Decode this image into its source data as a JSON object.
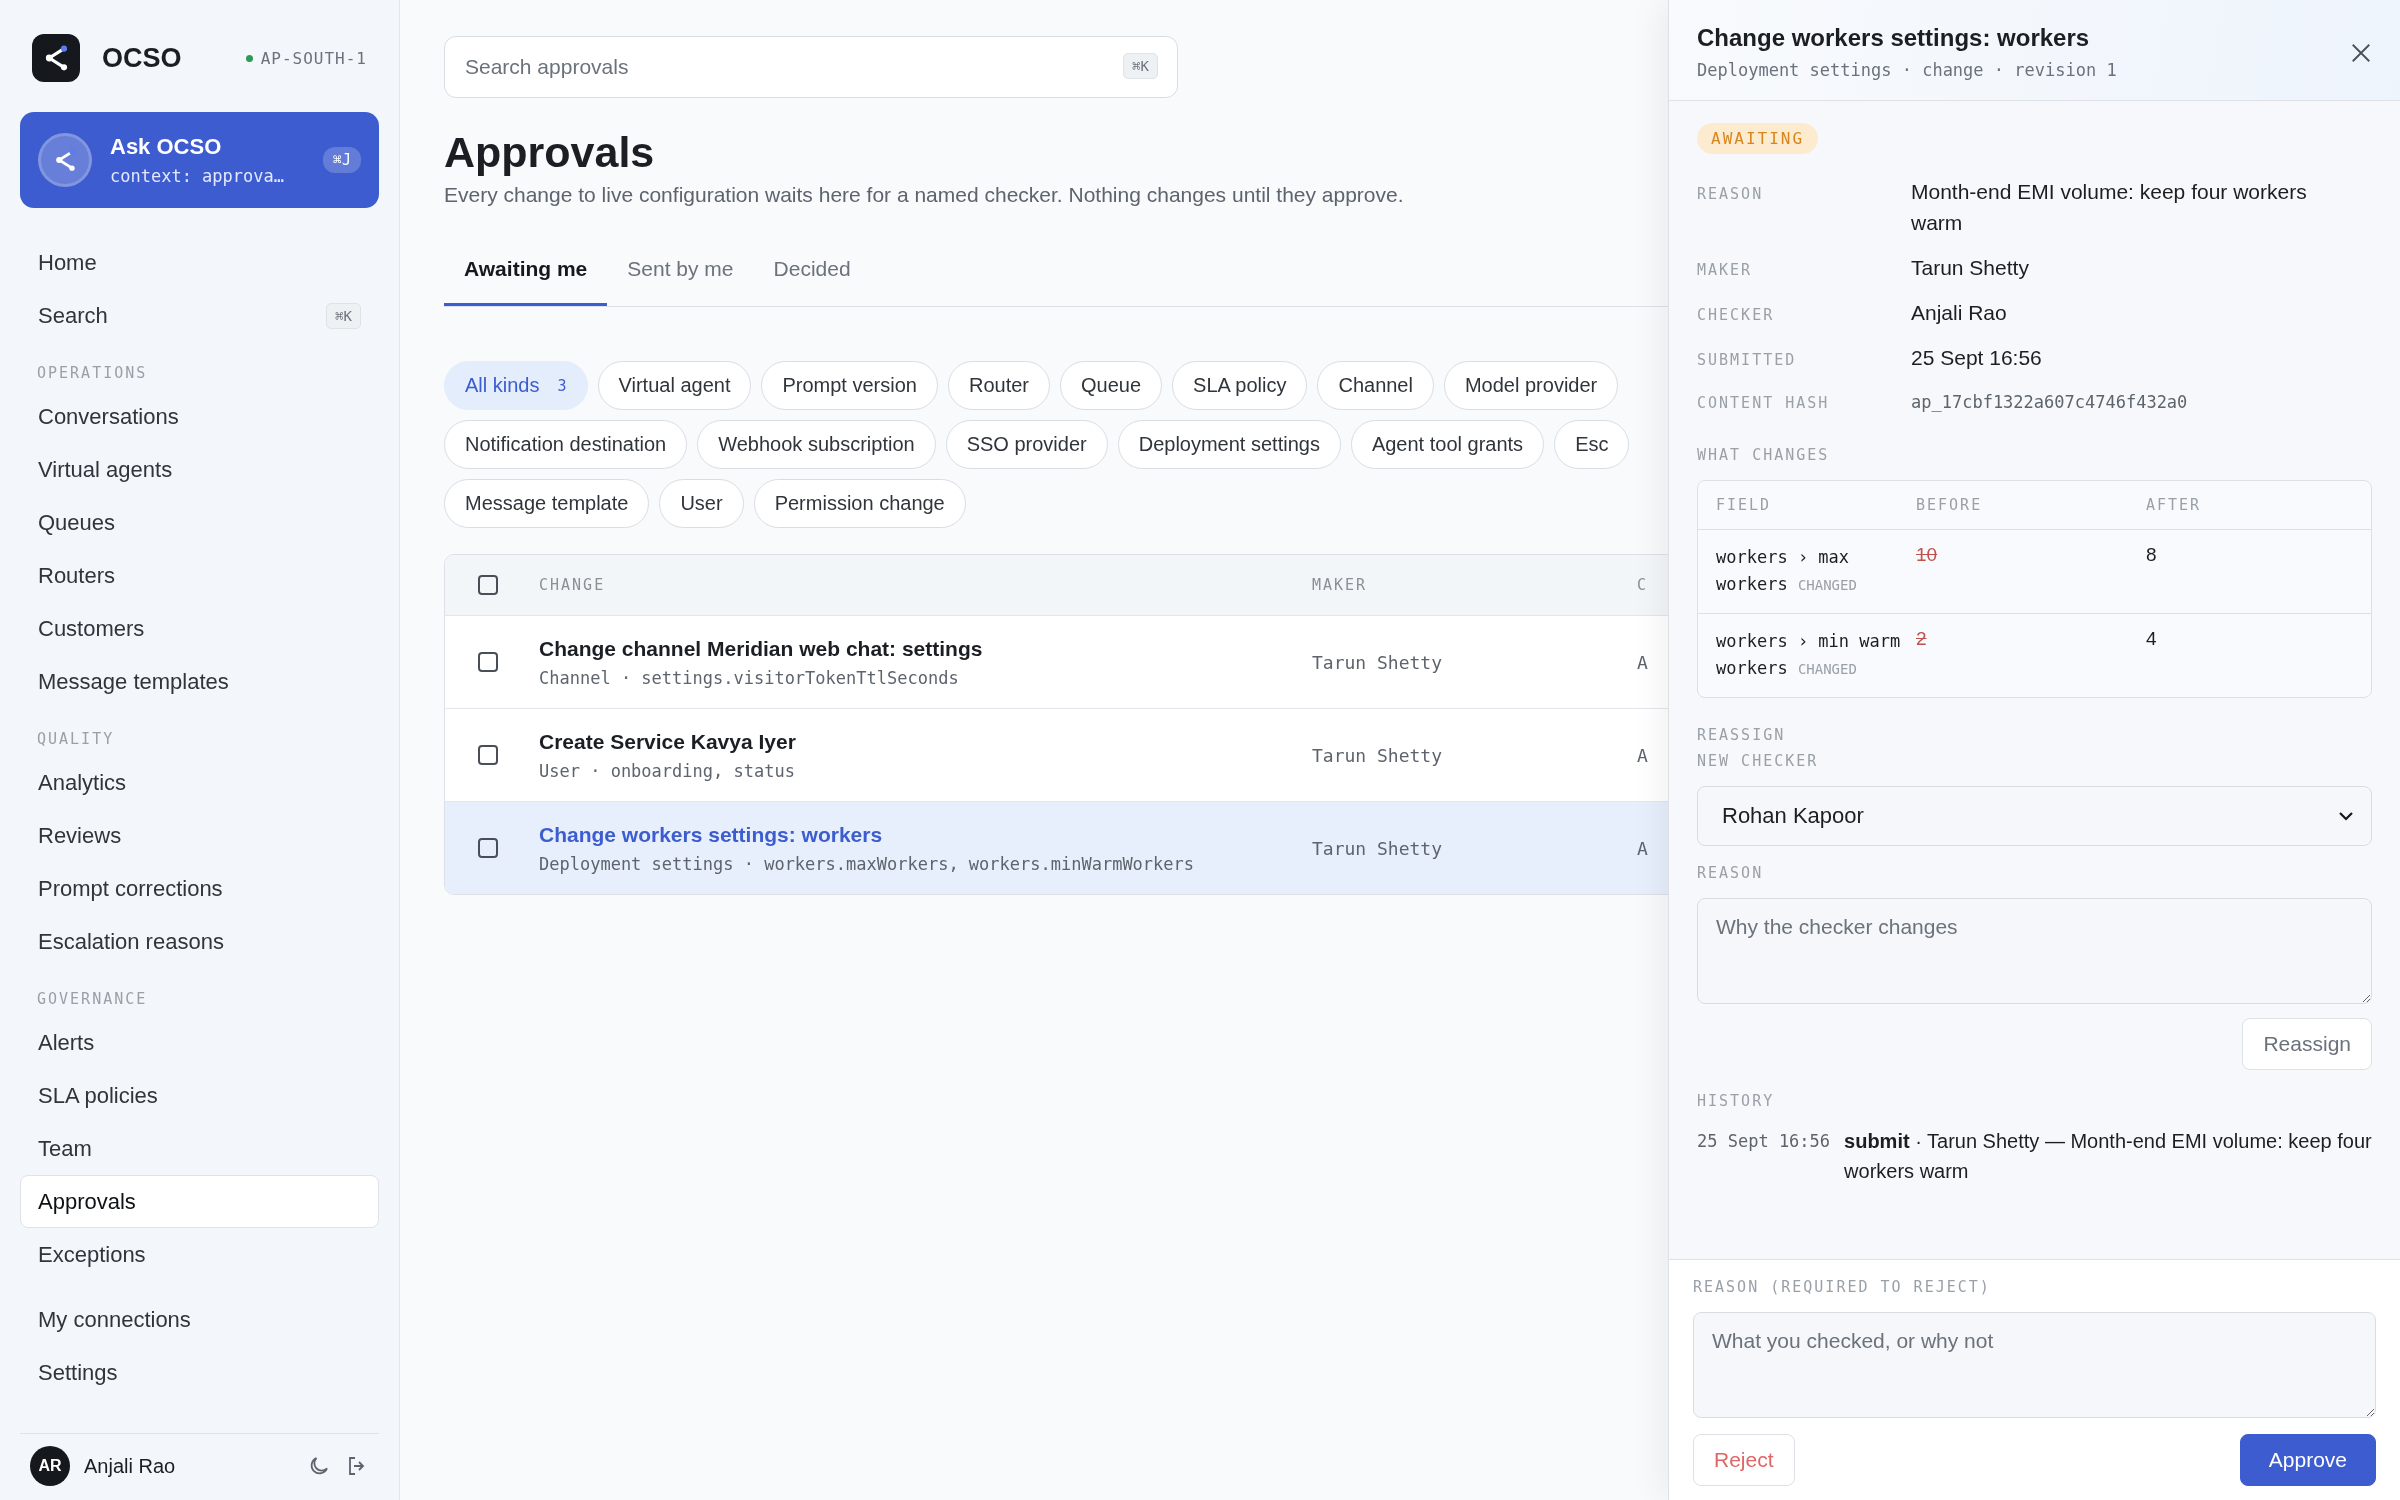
{
  "sidebar": {
    "brand": "OCSO",
    "region": "AP-SOUTH-1",
    "ask": {
      "title": "Ask OCSO",
      "context": "context: approva…",
      "shortcut": "⌘J"
    },
    "sections": [
      {
        "items": [
          {
            "label": "Home",
            "selected": false
          },
          {
            "label": "Search",
            "selected": false,
            "shortcut": "⌘K"
          }
        ]
      },
      {
        "heading": "OPERATIONS",
        "items": [
          {
            "label": "Conversations",
            "selected": false
          },
          {
            "label": "Virtual agents",
            "selected": false
          },
          {
            "label": "Queues",
            "selected": false
          },
          {
            "label": "Routers",
            "selected": false
          },
          {
            "label": "Customers",
            "selected": false
          },
          {
            "label": "Message templates",
            "selected": false
          }
        ]
      },
      {
        "heading": "QUALITY",
        "items": [
          {
            "label": "Analytics",
            "selected": false
          },
          {
            "label": "Reviews",
            "selected": false
          },
          {
            "label": "Prompt corrections",
            "selected": false
          },
          {
            "label": "Escalation reasons",
            "selected": false
          }
        ]
      },
      {
        "heading": "GOVERNANCE",
        "items": [
          {
            "label": "Alerts",
            "selected": false
          },
          {
            "label": "SLA policies",
            "selected": false
          },
          {
            "label": "Team",
            "selected": false
          },
          {
            "label": "Approvals",
            "selected": true
          },
          {
            "label": "Exceptions",
            "selected": false
          }
        ]
      },
      {
        "items": [
          {
            "label": "My connections",
            "selected": false
          },
          {
            "label": "Settings",
            "selected": false
          }
        ]
      }
    ],
    "user": {
      "initials": "AR",
      "name": "Anjali Rao"
    }
  },
  "main": {
    "search": {
      "placeholder": "Search approvals",
      "shortcut": "⌘K"
    },
    "title": "Approvals",
    "subtitle": "Every change to live configuration waits here for a named checker. Nothing changes until they approve.",
    "tabs": [
      {
        "label": "Awaiting me",
        "selected": true
      },
      {
        "label": "Sent by me",
        "selected": false
      },
      {
        "label": "Decided",
        "selected": false
      }
    ],
    "filter_rows": [
      {
        "chips": [
          {
            "label": "All kinds",
            "count": "3",
            "selected": true
          },
          {
            "label": "Virtual agent",
            "selected": false
          },
          {
            "label": "Prompt version",
            "selected": false
          },
          {
            "label": "Router",
            "selected": false
          },
          {
            "label": "Queue",
            "selected": false
          },
          {
            "label": "SLA policy",
            "selected": false
          },
          {
            "label": "Channel",
            "selected": false
          },
          {
            "label": "Model provider",
            "selected": false
          }
        ]
      },
      {
        "chips": [
          {
            "label": "Notification destination",
            "selected": false
          },
          {
            "label": "Webhook subscription",
            "selected": false
          },
          {
            "label": "SSO provider",
            "selected": false
          },
          {
            "label": "Deployment settings",
            "selected": false
          },
          {
            "label": "Agent tool grants",
            "selected": false
          },
          {
            "label": "Esc",
            "selected": false
          }
        ]
      },
      {
        "chips": [
          {
            "label": "Message template",
            "selected": false
          },
          {
            "label": "User",
            "selected": false
          },
          {
            "label": "Permission change",
            "selected": false
          }
        ]
      }
    ],
    "table": {
      "select_all_checked": false,
      "columns": [
        "CHANGE",
        "MAKER",
        "C"
      ],
      "rows": [
        {
          "title": "Change channel Meridian web chat: settings",
          "detail": "Channel · settings.visitorTokenTtlSeconds",
          "maker": "Tarun Shetty",
          "column_3": "A",
          "checked": false,
          "selected": false
        },
        {
          "title": "Create Service Kavya Iyer",
          "detail": "User · onboarding, status",
          "maker": "Tarun Shetty",
          "column_3": "A",
          "checked": false,
          "selected": false
        },
        {
          "title": "Change workers settings: workers",
          "detail": "Deployment settings · workers.maxWorkers, workers.minWarmWorkers",
          "maker": "Tarun Shetty",
          "column_3": "A",
          "checked": false,
          "selected": true
        }
      ]
    }
  },
  "panel": {
    "title": "Change workers settings: workers",
    "subtitle": "Deployment settings · change · revision 1",
    "status": "AWAITING",
    "fields": [
      {
        "label": "REASON",
        "value": "Month-end EMI volume: keep four workers warm",
        "kind": "text"
      },
      {
        "label": "MAKER",
        "value": "Tarun Shetty",
        "kind": "text"
      },
      {
        "label": "CHECKER",
        "value": "Anjali Rao",
        "kind": "text"
      },
      {
        "label": "SUBMITTED",
        "value": "25 Sept 16:56",
        "kind": "text"
      },
      {
        "label": "CONTENT HASH",
        "value": "ap_17cbf1322a607c4746f432a0",
        "kind": "code"
      }
    ],
    "what_changes": "WHAT CHANGES",
    "diff": {
      "columns": [
        "FIELD",
        "BEFORE",
        "AFTER"
      ],
      "rows": [
        {
          "field": "workers › max workers",
          "tag": "CHANGED",
          "before": "10",
          "after": "8"
        },
        {
          "field": "workers › min warm workers",
          "tag": "CHANGED",
          "before": "2",
          "after": "4"
        }
      ]
    },
    "reassign": {
      "heading": "REASSIGN",
      "checker_label": "NEW CHECKER",
      "checker": "Rohan Kapoor",
      "reason_label": "REASON",
      "reason_placeholder": "Why the checker changes",
      "button": "Reassign"
    },
    "history_heading": "HISTORY",
    "history": [
      {
        "time": "25 Sept 16:56",
        "text": "**submit** · Tarun Shetty — Month-end EMI volume: keep four workers warm"
      }
    ],
    "footer": {
      "reason_label": "REASON (REQUIRED TO REJECT)",
      "reason_placeholder": "What you checked, or why not",
      "reject": "Reject",
      "approve": "Approve"
    }
  }
}
